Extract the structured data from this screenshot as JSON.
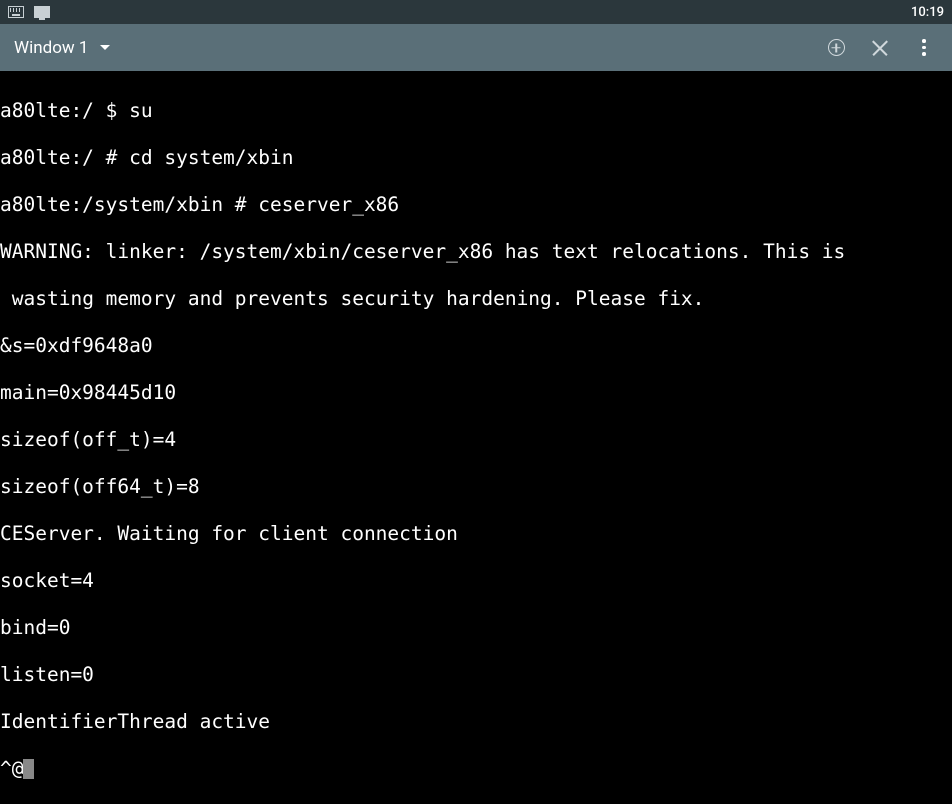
{
  "statusBar": {
    "clock": "10:19"
  },
  "toolbar": {
    "windowLabel": "Window 1"
  },
  "terminal": {
    "lines": [
      "a80lte:/ $ su",
      "a80lte:/ # cd system/xbin",
      "a80lte:/system/xbin # ceserver_x86",
      "WARNING: linker: /system/xbin/ceserver_x86 has text relocations. This is",
      " wasting memory and prevents security hardening. Please fix.",
      "&s=0xdf9648a0",
      "main=0x98445d10",
      "sizeof(off_t)=4",
      "sizeof(off64_t)=8",
      "CEServer. Waiting for client connection",
      "socket=4",
      "bind=0",
      "listen=0",
      "IdentifierThread active",
      "^@"
    ]
  }
}
